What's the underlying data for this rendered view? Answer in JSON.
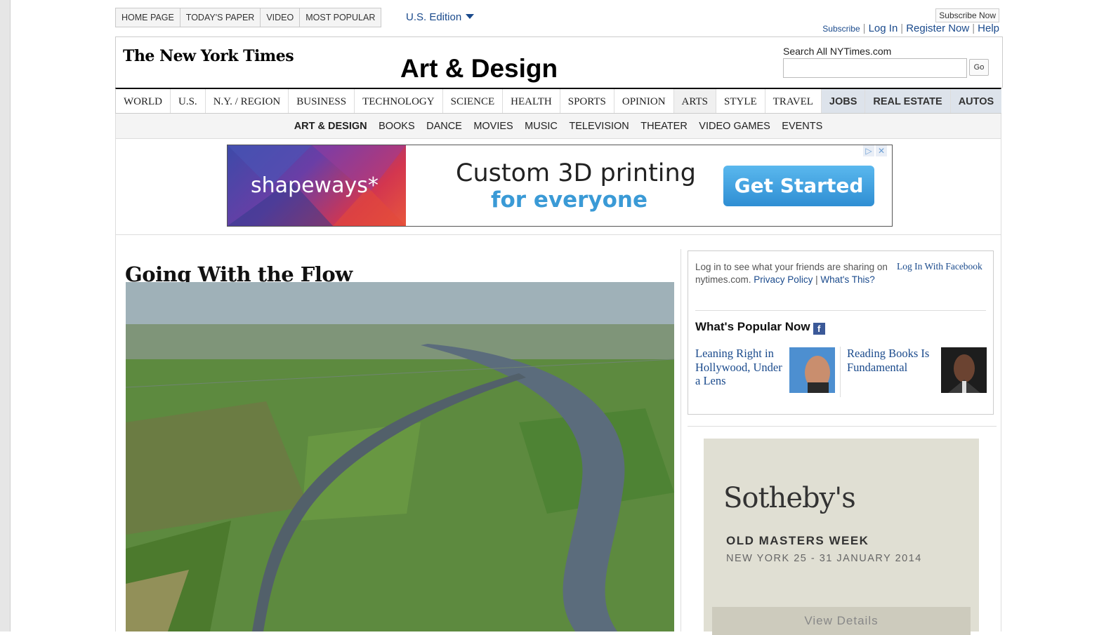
{
  "topnav": {
    "links": [
      "HOME PAGE",
      "TODAY'S PAPER",
      "VIDEO",
      "MOST POPULAR"
    ],
    "edition": "U.S. Edition"
  },
  "account": {
    "subscribe_now": "Subscribe Now",
    "subscribe": "Subscribe",
    "login": "Log In",
    "register": "Register Now",
    "help": "Help"
  },
  "masthead": {
    "logo": "The New York Times",
    "section": "Art & Design"
  },
  "search": {
    "label": "Search All NYTimes.com",
    "placeholder": "",
    "go": "Go"
  },
  "mainnav": [
    "WORLD",
    "U.S.",
    "N.Y. / REGION",
    "BUSINESS",
    "TECHNOLOGY",
    "SCIENCE",
    "HEALTH",
    "SPORTS",
    "OPINION",
    "ARTS",
    "STYLE",
    "TRAVEL",
    "JOBS",
    "REAL ESTATE",
    "AUTOS"
  ],
  "subnav": [
    "ART & DESIGN",
    "BOOKS",
    "DANCE",
    "MOVIES",
    "MUSIC",
    "TELEVISION",
    "THEATER",
    "VIDEO GAMES",
    "EVENTS"
  ],
  "ad": {
    "brand": "shapeways*",
    "headline": "Custom 3D printing",
    "subline": "for everyone",
    "cta": "Get Started"
  },
  "article": {
    "headline": "Going With the Flow"
  },
  "social": {
    "intro": "Log in to see what your friends are sharing on nytimes.com.",
    "privacy": "Privacy Policy",
    "sep": "|",
    "whats_this": "What's This?",
    "fb_login": "Log In With Facebook",
    "popular_title": "What's Popular Now",
    "popular": [
      {
        "title": "Leaning Right in Hollywood, Under a Lens"
      },
      {
        "title": "Reading Books Is Fundamental"
      }
    ]
  },
  "sothebys": {
    "logo": "Sotheby's",
    "title": "OLD MASTERS WEEK",
    "sub": "NEW YORK  25 - 31 JANUARY 2014",
    "cta": "View Details"
  }
}
